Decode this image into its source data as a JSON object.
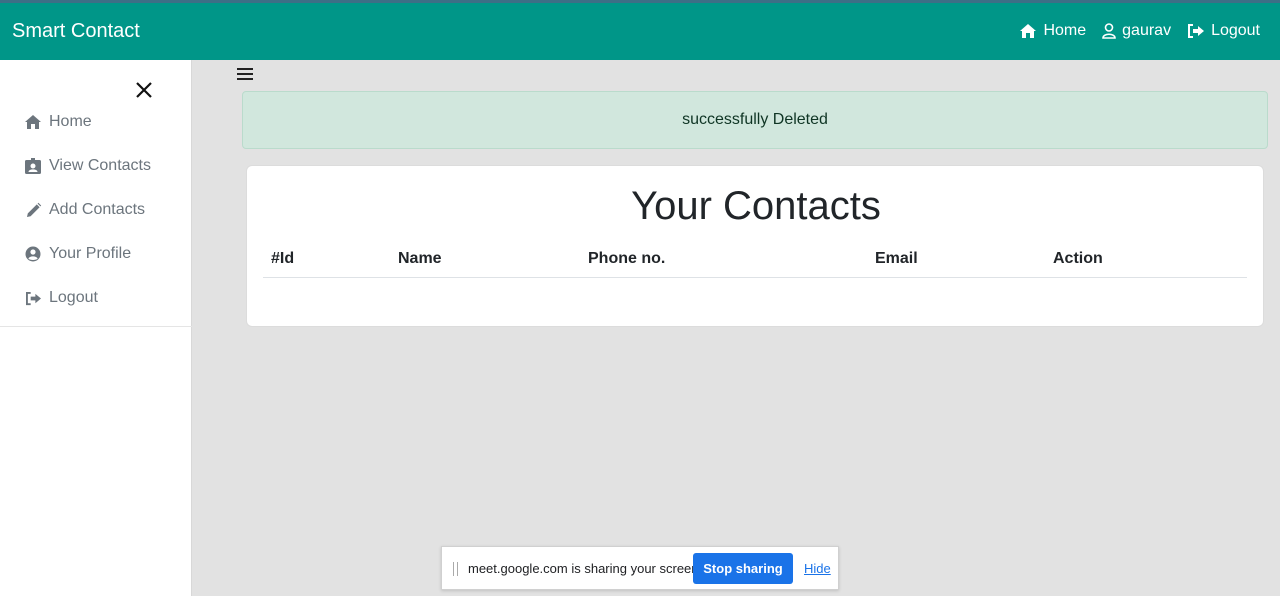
{
  "navbar": {
    "brand": "Smart Contact",
    "links": [
      {
        "label": "Home",
        "icon": "home-icon"
      },
      {
        "label": "gaurav",
        "icon": "user-icon"
      },
      {
        "label": "Logout",
        "icon": "logout-icon"
      }
    ],
    "color": "#009688"
  },
  "sidebar": {
    "items": [
      {
        "label": "Home",
        "icon": "home-icon"
      },
      {
        "label": "View Contacts",
        "icon": "contact-card-icon"
      },
      {
        "label": "Add Contacts",
        "icon": "pencil-icon"
      },
      {
        "label": "Your Profile",
        "icon": "user-circle-icon"
      },
      {
        "label": "Logout",
        "icon": "logout-icon"
      }
    ]
  },
  "alert": {
    "message": "successfully Deleted",
    "color": "#d1e7dd"
  },
  "contacts": {
    "title": "Your Contacts",
    "columns": [
      "#Id",
      "Name",
      "Phone no.",
      "Email",
      "Action"
    ],
    "rows": []
  },
  "share_bar": {
    "message": "meet.google.com is sharing your screen.",
    "stop_label": "Stop sharing",
    "hide_label": "Hide"
  }
}
